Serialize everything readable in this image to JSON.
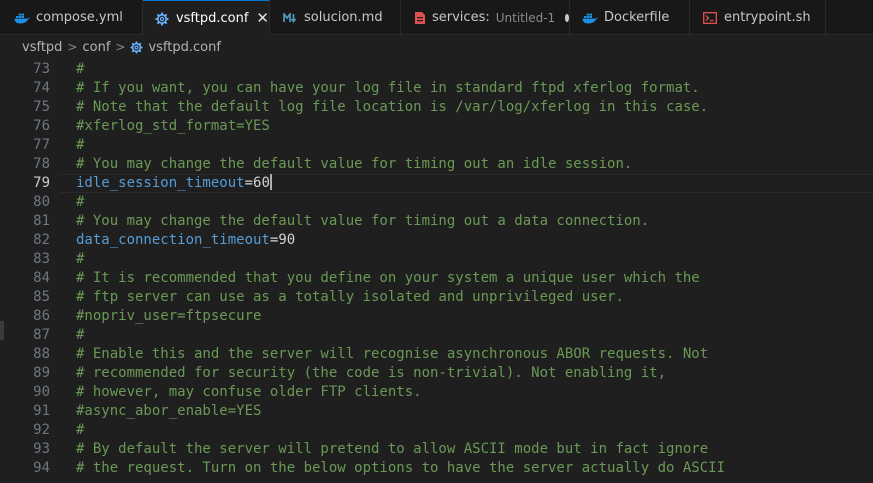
{
  "tabs": [
    {
      "label": "compose.yml",
      "icon": "docker-icon"
    },
    {
      "label": "vsftpd.conf",
      "icon": "gear-icon",
      "active": true,
      "close": "✕"
    },
    {
      "label": "solucion.md",
      "icon": "markdown-icon"
    },
    {
      "label": "services:",
      "description": "Untitled-1",
      "icon": "file-icon",
      "modified": true
    },
    {
      "label": "Dockerfile",
      "icon": "docker-icon"
    },
    {
      "label": "entrypoint.sh",
      "icon": "terminal-icon"
    }
  ],
  "breadcrumb": {
    "items": [
      "vsftpd",
      "conf",
      "vsftpd.conf"
    ],
    "separator": ">"
  },
  "editor": {
    "current_line": "79",
    "lines": [
      {
        "n": "73",
        "t": "#"
      },
      {
        "n": "74",
        "t": "# If you want, you can have your log file in standard ftpd xferlog format."
      },
      {
        "n": "75",
        "t": "# Note that the default log file location is /var/log/xferlog in this case."
      },
      {
        "n": "76",
        "t": "#xferlog_std_format=YES"
      },
      {
        "n": "77",
        "t": "#"
      },
      {
        "n": "78",
        "t": "# You may change the default value for timing out an idle session."
      },
      {
        "n": "79",
        "key": "idle_session_timeout",
        "val": "60"
      },
      {
        "n": "80",
        "t": "#"
      },
      {
        "n": "81",
        "t": "# You may change the default value for timing out a data connection."
      },
      {
        "n": "82",
        "key": "data_connection_timeout",
        "val": "90"
      },
      {
        "n": "83",
        "t": "#"
      },
      {
        "n": "84",
        "t": "# It is recommended that you define on your system a unique user which the"
      },
      {
        "n": "85",
        "t": "# ftp server can use as a totally isolated and unprivileged user."
      },
      {
        "n": "86",
        "t": "#nopriv_user=ftpsecure"
      },
      {
        "n": "87",
        "t": "#"
      },
      {
        "n": "88",
        "t": "# Enable this and the server will recognise asynchronous ABOR requests. Not"
      },
      {
        "n": "89",
        "t": "# recommended for security (the code is non-trivial). Not enabling it,"
      },
      {
        "n": "90",
        "t": "# however, may confuse older FTP clients."
      },
      {
        "n": "91",
        "t": "#async_abor_enable=YES"
      },
      {
        "n": "92",
        "t": "#"
      },
      {
        "n": "93",
        "t": "# By default the server will pretend to allow ASCII mode but in fact ignore"
      },
      {
        "n": "94",
        "t": "# the request. Turn on the below options to have the server actually do ASCII"
      }
    ]
  },
  "colors": {
    "comment": "#6a9955",
    "key": "#569cd6",
    "accent": "#0078d4",
    "docker": "#1d91e6",
    "markdown": "#519aba",
    "gear": "#6cb6ff",
    "file_red": "#e05252",
    "terminal_red": "#e05252"
  }
}
